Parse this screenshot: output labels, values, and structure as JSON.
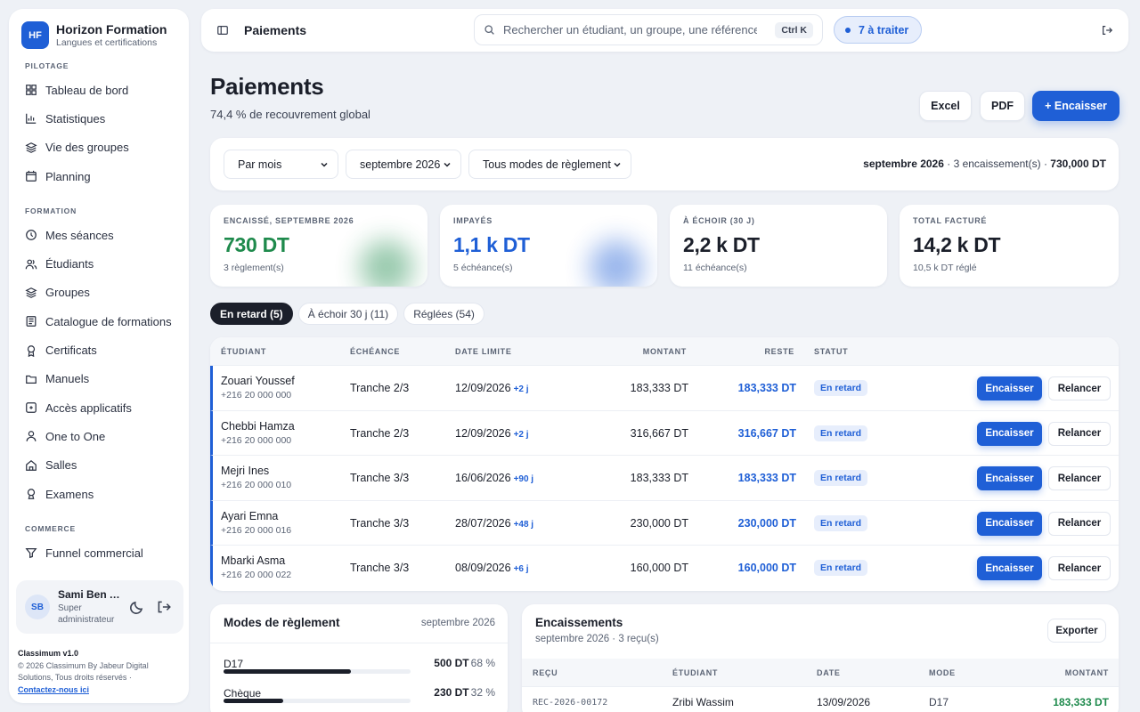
{
  "brand": {
    "initials": "HF",
    "name": "Horizon Formation",
    "tagline": "Langues et certifications"
  },
  "nav": {
    "sections": [
      {
        "title": "PILOTAGE",
        "items": [
          {
            "label": "Tableau de bord",
            "icon": "dashboard-icon"
          },
          {
            "label": "Statistiques",
            "icon": "chart-icon"
          },
          {
            "label": "Vie des groupes",
            "icon": "layers-icon"
          },
          {
            "label": "Planning",
            "icon": "calendar-icon"
          }
        ]
      },
      {
        "title": "FORMATION",
        "items": [
          {
            "label": "Mes séances",
            "icon": "clock-icon"
          },
          {
            "label": "Étudiants",
            "icon": "students-icon"
          },
          {
            "label": "Groupes",
            "icon": "layers-icon"
          },
          {
            "label": "Catalogue de formations",
            "icon": "catalog-icon"
          },
          {
            "label": "Certificats",
            "icon": "award-icon"
          },
          {
            "label": "Manuels",
            "icon": "folder-icon"
          },
          {
            "label": "Accès applicatifs",
            "icon": "app-icon"
          },
          {
            "label": "One to One",
            "icon": "user-icon"
          },
          {
            "label": "Salles",
            "icon": "home-icon"
          },
          {
            "label": "Examens",
            "icon": "pin-icon"
          }
        ]
      },
      {
        "title": "COMMERCE",
        "items": [
          {
            "label": "Funnel commercial",
            "icon": "funnel-icon"
          }
        ]
      }
    ]
  },
  "user": {
    "initials": "SB",
    "name": "Sami Ben Ali",
    "role": "Super administrateur"
  },
  "footer": {
    "version": "Classimum v1.0",
    "copyright": "© 2026 Classimum By Jabeur Digital Solutions, Tous droits réservés ·",
    "contact": "Contactez-nous ici"
  },
  "topbar": {
    "title": "Paiements",
    "search_placeholder": "Rechercher un étudiant, un groupe, une référence…",
    "shortcut": "Ctrl K",
    "todo": "7 à traiter"
  },
  "page": {
    "title": "Paiements",
    "subtitle": "74,4 % de recouvrement global",
    "actions": {
      "excel": "Excel",
      "pdf": "PDF",
      "collect": "+ Encaisser"
    }
  },
  "filters": {
    "period_mode": "Par mois",
    "month": "septembre 2026",
    "method": "Tous modes de règlement",
    "summary_month": "septembre 2026",
    "summary_count": " · 3 encaissement(s) · ",
    "summary_total": "730,000 DT"
  },
  "kpis": [
    {
      "label": "ENCAISSÉ, SEPTEMBRE 2026",
      "value": "730 DT",
      "sub": "3 règlement(s)",
      "color": "#1e8a4c"
    },
    {
      "label": "IMPAYÉS",
      "value": "1,1 k DT",
      "sub": "5 échéance(s)",
      "color": "#1f5fd6"
    },
    {
      "label": "À ÉCHOIR (30 J)",
      "value": "2,2 k DT",
      "sub": "11 échéance(s)",
      "color": "#1b1f2a"
    },
    {
      "label": "TOTAL FACTURÉ",
      "value": "14,2 k DT",
      "sub": "10,5 k DT réglé",
      "color": "#1b1f2a"
    }
  ],
  "tabs": [
    {
      "label": "En retard (5)",
      "active": true
    },
    {
      "label": "À échoir 30 j (11)",
      "active": false
    },
    {
      "label": "Réglées (54)",
      "active": false
    }
  ],
  "table": {
    "headers": {
      "student": "ÉTUDIANT",
      "installment": "ÉCHÉANCE",
      "due": "DATE LIMITE",
      "amount": "MONTANT",
      "rest": "RESTE",
      "status": "STATUT"
    },
    "rows": [
      {
        "name": "Zouari Youssef",
        "phone": "+216 20 000 000",
        "installment": "Tranche 2/3",
        "due": "12/09/2026",
        "delay": "+2 j",
        "amount": "183,333 DT",
        "rest": "183,333 DT",
        "status": "En retard",
        "collect": "Encaisser",
        "remind": "Relancer"
      },
      {
        "name": "Chebbi Hamza",
        "phone": "+216 20 000 000",
        "installment": "Tranche 2/3",
        "due": "12/09/2026",
        "delay": "+2 j",
        "amount": "316,667 DT",
        "rest": "316,667 DT",
        "status": "En retard",
        "collect": "Encaisser",
        "remind": "Relancer"
      },
      {
        "name": "Mejri Ines",
        "phone": "+216 20 000 010",
        "installment": "Tranche 3/3",
        "due": "16/06/2026",
        "delay": "+90 j",
        "amount": "183,333 DT",
        "rest": "183,333 DT",
        "status": "En retard",
        "collect": "Encaisser",
        "remind": "Relancer"
      },
      {
        "name": "Ayari Emna",
        "phone": "+216 20 000 016",
        "installment": "Tranche 3/3",
        "due": "28/07/2026",
        "delay": "+48 j",
        "amount": "230,000 DT",
        "rest": "230,000 DT",
        "status": "En retard",
        "collect": "Encaisser",
        "remind": "Relancer"
      },
      {
        "name": "Mbarki Asma",
        "phone": "+216 20 000 022",
        "installment": "Tranche 3/3",
        "due": "08/09/2026",
        "delay": "+6 j",
        "amount": "160,000 DT",
        "rest": "160,000 DT",
        "status": "En retard",
        "collect": "Encaisser",
        "remind": "Relancer"
      }
    ]
  },
  "modes": {
    "title": "Modes de règlement",
    "period": "septembre 2026",
    "items": [
      {
        "name": "D17",
        "value": "500 DT",
        "pct": "68 %",
        "fraction": 0.68
      },
      {
        "name": "Chèque",
        "value": "230 DT",
        "pct": "32 %",
        "fraction": 0.32
      }
    ]
  },
  "receipts": {
    "title": "Encaissements",
    "subtitle": "septembre 2026 · 3 reçu(s)",
    "export": "Exporter",
    "headers": {
      "receipt": "REÇU",
      "student": "ÉTUDIANT",
      "date": "DATE",
      "mode": "MODE",
      "amount": "MONTANT"
    },
    "rows": [
      {
        "receipt": "REC-2026-00172",
        "student": "Zribi Wassim",
        "date": "13/09/2026",
        "mode": "D17",
        "amount": "183,333 DT"
      }
    ]
  },
  "colors": {
    "accent": "#1f5fd6",
    "success": "#1e8a4c",
    "ink": "#1b1f2a"
  }
}
